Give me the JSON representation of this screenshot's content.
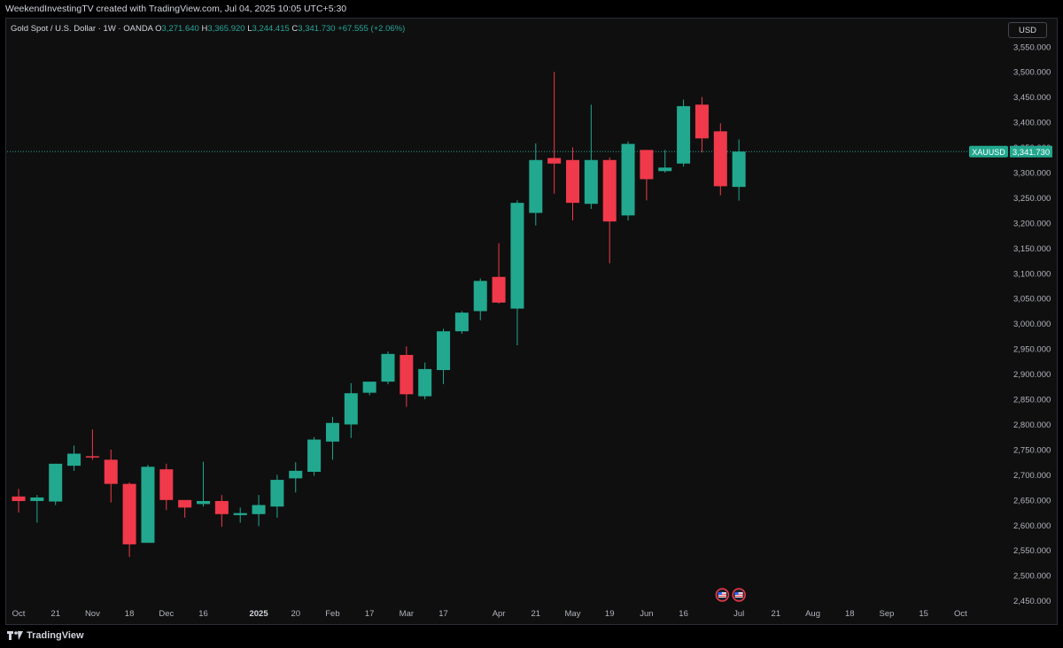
{
  "header": {
    "credit": "WeekendInvestingTV created with TradingView.com, Jul 04, 2025 10:05 UTC+5:30",
    "symbol_desc": "Gold Spot / U.S. Dollar · 1W · OANDA",
    "open_label": "O",
    "open": "3,271.640",
    "high_label": "H",
    "high": "3,365.920",
    "low_label": "L",
    "low": "3,244.415",
    "close_label": "C",
    "close": "3,341.730",
    "change": "+67.555 (+2.06%)",
    "currency": "USD"
  },
  "footer": {
    "brand": "TradingView"
  },
  "colors": {
    "up": "#22a88f",
    "down": "#f0394a",
    "background": "#0f0f0f",
    "text": "#b2b5be",
    "price_line": "#22a88f"
  },
  "chart_data": {
    "type": "candlestick",
    "interval": "1W",
    "ylim": [
      2430,
      3590
    ],
    "price_label": {
      "symbol": "XAUUSD",
      "value": "3,341.730",
      "price": 3341.73
    },
    "y_ticks": [
      2450,
      2500,
      2550,
      2600,
      2650,
      2700,
      2750,
      2800,
      2850,
      2900,
      2950,
      3000,
      3050,
      3100,
      3150,
      3200,
      3250,
      3300,
      3350,
      3400,
      3450,
      3500,
      3550
    ],
    "y_tick_labels": [
      "2,450.000",
      "2,500.000",
      "2,550.000",
      "2,600.000",
      "2,650.000",
      "2,700.000",
      "2,750.000",
      "2,800.000",
      "2,850.000",
      "2,900.000",
      "2,950.000",
      "3,000.000",
      "3,050.000",
      "3,100.000",
      "3,150.000",
      "3,200.000",
      "3,250.000",
      "3,300.000",
      "3,350.000",
      "3,400.000",
      "3,450.000",
      "3,500.000",
      "3,550.000"
    ],
    "x_labels": [
      {
        "label": "Oct",
        "week": 0
      },
      {
        "label": "21",
        "week": 2
      },
      {
        "label": "Nov",
        "week": 4
      },
      {
        "label": "18",
        "week": 6
      },
      {
        "label": "Dec",
        "week": 8
      },
      {
        "label": "16",
        "week": 10
      },
      {
        "label": "2025",
        "week": 13,
        "bold": true
      },
      {
        "label": "20",
        "week": 15
      },
      {
        "label": "Feb",
        "week": 17
      },
      {
        "label": "17",
        "week": 19
      },
      {
        "label": "Mar",
        "week": 21
      },
      {
        "label": "17",
        "week": 23
      },
      {
        "label": "Apr",
        "week": 26
      },
      {
        "label": "21",
        "week": 28
      },
      {
        "label": "May",
        "week": 30
      },
      {
        "label": "19",
        "week": 32
      },
      {
        "label": "Jun",
        "week": 34
      },
      {
        "label": "16",
        "week": 36
      },
      {
        "label": "Jul",
        "week": 39
      },
      {
        "label": "21",
        "week": 41
      },
      {
        "label": "Aug",
        "week": 43
      },
      {
        "label": "18",
        "week": 45
      },
      {
        "label": "Sep",
        "week": 47
      },
      {
        "label": "15",
        "week": 49
      },
      {
        "label": "Oct",
        "week": 51
      }
    ],
    "events": [
      {
        "week": 38.1,
        "icon": "us-flag-icon"
      },
      {
        "week": 39,
        "icon": "us-flag-icon"
      }
    ],
    "candles": [
      {
        "o": 2657,
        "h": 2672,
        "l": 2625,
        "c": 2648
      },
      {
        "o": 2648,
        "h": 2660,
        "l": 2605,
        "c": 2655
      },
      {
        "o": 2647,
        "h": 2722,
        "l": 2640,
        "c": 2722
      },
      {
        "o": 2718,
        "h": 2758,
        "l": 2708,
        "c": 2742
      },
      {
        "o": 2737,
        "h": 2790,
        "l": 2730,
        "c": 2735
      },
      {
        "o": 2730,
        "h": 2750,
        "l": 2645,
        "c": 2682
      },
      {
        "o": 2682,
        "h": 2685,
        "l": 2537,
        "c": 2562
      },
      {
        "o": 2565,
        "h": 2720,
        "l": 2565,
        "c": 2716
      },
      {
        "o": 2711,
        "h": 2722,
        "l": 2630,
        "c": 2650
      },
      {
        "o": 2650,
        "h": 2650,
        "l": 2615,
        "c": 2635
      },
      {
        "o": 2642,
        "h": 2726,
        "l": 2637,
        "c": 2648
      },
      {
        "o": 2648,
        "h": 2660,
        "l": 2597,
        "c": 2622
      },
      {
        "o": 2620,
        "h": 2635,
        "l": 2605,
        "c": 2624
      },
      {
        "o": 2622,
        "h": 2660,
        "l": 2598,
        "c": 2640
      },
      {
        "o": 2637,
        "h": 2700,
        "l": 2615,
        "c": 2690
      },
      {
        "o": 2693,
        "h": 2725,
        "l": 2665,
        "c": 2708
      },
      {
        "o": 2706,
        "h": 2775,
        "l": 2698,
        "c": 2770
      },
      {
        "o": 2766,
        "h": 2815,
        "l": 2730,
        "c": 2803
      },
      {
        "o": 2800,
        "h": 2882,
        "l": 2773,
        "c": 2862
      },
      {
        "o": 2863,
        "h": 2880,
        "l": 2858,
        "c": 2885
      },
      {
        "o": 2885,
        "h": 2945,
        "l": 2880,
        "c": 2940
      },
      {
        "o": 2938,
        "h": 2955,
        "l": 2835,
        "c": 2860
      },
      {
        "o": 2856,
        "h": 2923,
        "l": 2850,
        "c": 2910
      },
      {
        "o": 2908,
        "h": 2990,
        "l": 2880,
        "c": 2985
      },
      {
        "o": 2985,
        "h": 3025,
        "l": 2980,
        "c": 3022
      },
      {
        "o": 3025,
        "h": 3090,
        "l": 3007,
        "c": 3085
      },
      {
        "o": 3093,
        "h": 3160,
        "l": 3040,
        "c": 3042
      },
      {
        "o": 3030,
        "h": 3245,
        "l": 2957,
        "c": 3240
      },
      {
        "o": 3220,
        "h": 3358,
        "l": 3195,
        "c": 3325
      },
      {
        "o": 3329,
        "h": 3500,
        "l": 3258,
        "c": 3318
      },
      {
        "o": 3325,
        "h": 3350,
        "l": 3205,
        "c": 3240
      },
      {
        "o": 3238,
        "h": 3435,
        "l": 3228,
        "c": 3325
      },
      {
        "o": 3325,
        "h": 3330,
        "l": 3120,
        "c": 3203
      },
      {
        "o": 3215,
        "h": 3362,
        "l": 3205,
        "c": 3357
      },
      {
        "o": 3345,
        "h": 3345,
        "l": 3245,
        "c": 3287
      },
      {
        "o": 3303,
        "h": 3345,
        "l": 3300,
        "c": 3310
      },
      {
        "o": 3318,
        "h": 3445,
        "l": 3312,
        "c": 3432
      },
      {
        "o": 3435,
        "h": 3450,
        "l": 3340,
        "c": 3368
      },
      {
        "o": 3382,
        "h": 3398,
        "l": 3255,
        "c": 3273
      },
      {
        "o": 3271.64,
        "h": 3365.92,
        "l": 3244.415,
        "c": 3341.73
      }
    ]
  }
}
